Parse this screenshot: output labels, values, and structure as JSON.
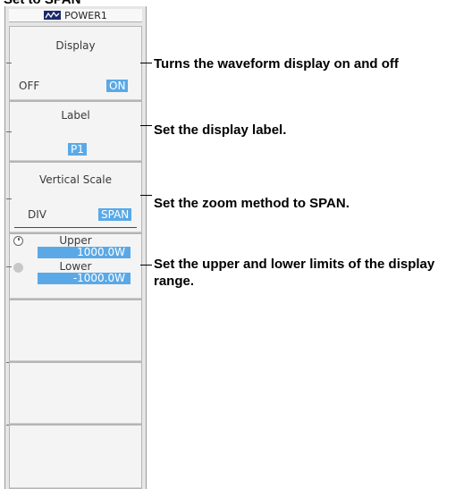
{
  "caption": "Set to SPAN",
  "panel": {
    "header": {
      "icon": "waveform-channel-icon",
      "title": "POWER1"
    },
    "display": {
      "title": "Display",
      "options": [
        "OFF",
        "ON"
      ],
      "selected": "ON"
    },
    "label": {
      "title": "Label",
      "value": "P1"
    },
    "vertical_scale": {
      "title": "Vertical Scale",
      "options": [
        "DIV",
        "SPAN"
      ],
      "selected": "SPAN"
    },
    "upper": {
      "label": "Upper",
      "value": "1000.0W",
      "icon": "jog-knob-icon"
    },
    "lower": {
      "label": "Lower",
      "value": "-1000.0W",
      "icon": "jog-knob-icon"
    }
  },
  "annotations": {
    "display": "Turns the waveform display on and off",
    "label": "Set the display label.",
    "vertical_scale": "Set the zoom method to SPAN.",
    "limits": "Set the upper and lower limits of the display range."
  },
  "colors": {
    "highlight": "#5aa9e6",
    "icon_bg": "#1b2a6b",
    "panel_bg": "#e6e6e6"
  }
}
